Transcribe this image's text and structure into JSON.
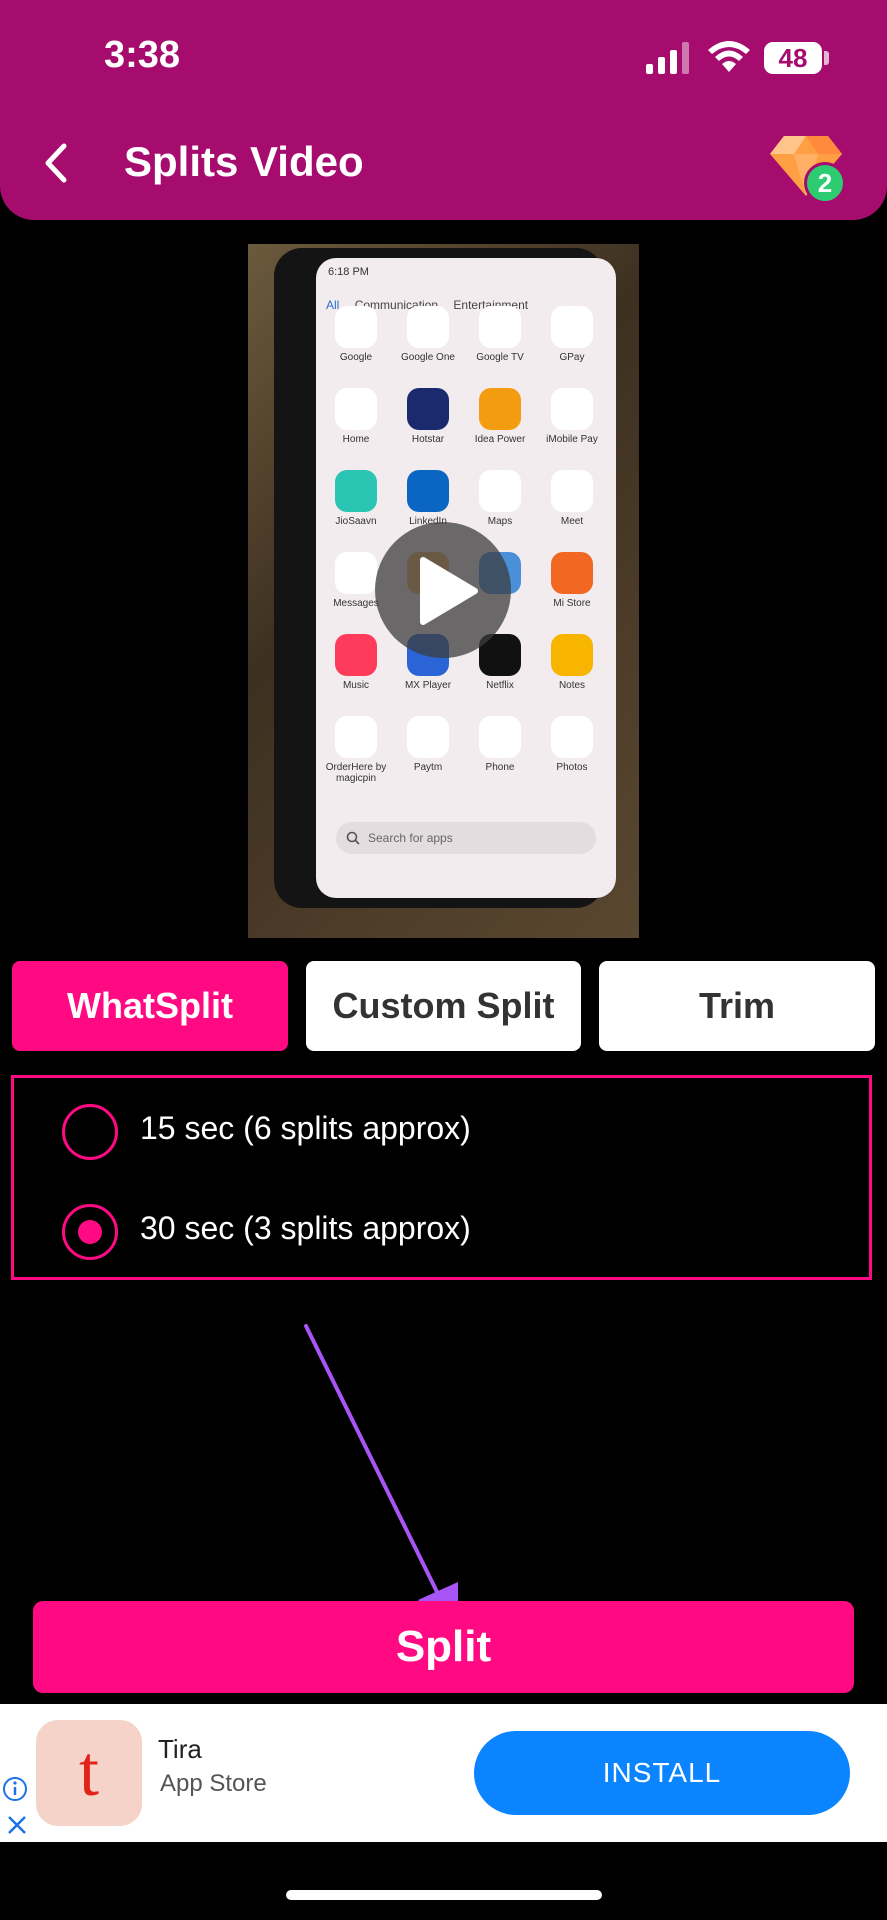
{
  "status_bar": {
    "time": "3:38",
    "battery": "48"
  },
  "header": {
    "title": "Splits Video",
    "gem_count": "2"
  },
  "video": {
    "screen_status": "6:18 PM",
    "screen_tabs": [
      "All",
      "Communication",
      "Entertainment"
    ],
    "apps": [
      {
        "label": "Google",
        "color": "#ffffff"
      },
      {
        "label": "Google One",
        "color": "#ffffff"
      },
      {
        "label": "Google TV",
        "color": "#ffffff"
      },
      {
        "label": "GPay",
        "color": "#ffffff"
      },
      {
        "label": "Home",
        "color": "#ffffff"
      },
      {
        "label": "Hotstar",
        "color": "#1a2a6c"
      },
      {
        "label": "Idea Power",
        "color": "#f39c12"
      },
      {
        "label": "iMobile Pay",
        "color": "#ffffff"
      },
      {
        "label": "JioSaavn",
        "color": "#2bc5b4"
      },
      {
        "label": "LinkedIn",
        "color": "#0a66c2"
      },
      {
        "label": "Maps",
        "color": "#ffffff"
      },
      {
        "label": "Meet",
        "color": "#ffffff"
      },
      {
        "label": "Messages",
        "color": "#ffffff"
      },
      {
        "label": "",
        "color": "#f0b060"
      },
      {
        "label": "",
        "color": "#4a90d9"
      },
      {
        "label": "Mi Store",
        "color": "#f26722"
      },
      {
        "label": "Music",
        "color": "#ff3b5c"
      },
      {
        "label": "MX Player",
        "color": "#2a64d6"
      },
      {
        "label": "Netflix",
        "color": "#111111"
      },
      {
        "label": "Notes",
        "color": "#f7b500"
      },
      {
        "label": "OrderHere by magicpin",
        "color": "#ffffff"
      },
      {
        "label": "Paytm",
        "color": "#ffffff"
      },
      {
        "label": "Phone",
        "color": "#ffffff"
      },
      {
        "label": "Photos",
        "color": "#ffffff"
      }
    ],
    "search_placeholder": "Search for apps"
  },
  "tabs": [
    {
      "label": "WhatSplit",
      "active": true
    },
    {
      "label": "Custom Split",
      "active": false
    },
    {
      "label": "Trim",
      "active": false
    }
  ],
  "options": [
    {
      "label": "15 sec (6 splits approx)",
      "selected": false
    },
    {
      "label": "30 sec (3 splits approx)",
      "selected": true
    }
  ],
  "split_button": "Split",
  "ad": {
    "logo_letter": "t",
    "name": "Tira",
    "store": "App Store",
    "install": "INSTALL"
  },
  "colors": {
    "header": "#a50c6e",
    "accent": "#ff0a83",
    "install": "#0a84ff",
    "arrow": "#a855f7"
  }
}
